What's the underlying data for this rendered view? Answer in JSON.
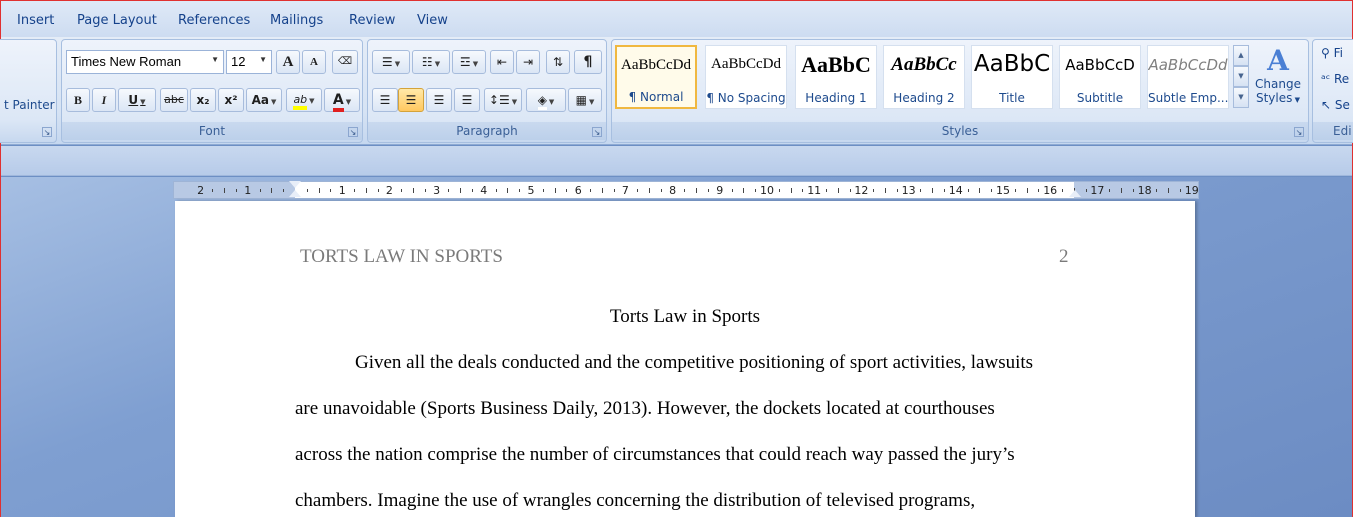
{
  "tabs": [
    "Insert",
    "Page Layout",
    "References",
    "Mailings",
    "Review",
    "View"
  ],
  "clipboard": {
    "format_painter_label": "t Painter"
  },
  "font_group": {
    "label": "Font",
    "font_name": "Times New Roman",
    "font_size": "12",
    "grow": "A",
    "shrink": "A",
    "bold": "B",
    "italic": "I",
    "underline": "U",
    "strike": "abc",
    "subscript": "x₂",
    "superscript": "x²",
    "change_case": "Aa",
    "highlight": "ab",
    "font_color": "A"
  },
  "paragraph_group": {
    "label": "Paragraph",
    "pilcrow": "¶"
  },
  "styles_group": {
    "label": "Styles",
    "change_styles": [
      "Change",
      "Styles"
    ],
    "tiles": [
      {
        "sample": "AaBbCcDd",
        "name": "¶ Normal"
      },
      {
        "sample": "AaBbCcDd",
        "name": "¶ No Spacing"
      },
      {
        "sample": "AaBbC",
        "name": "Heading 1"
      },
      {
        "sample": "AaBbCc",
        "name": "Heading 2"
      },
      {
        "sample": "AaBbC",
        "name": "Title"
      },
      {
        "sample": "AaBbCcD",
        "name": "Subtitle"
      },
      {
        "sample": "AaBbCcDd",
        "name": "Subtle Emp..."
      }
    ]
  },
  "editing_group": {
    "label": "Edi",
    "items": [
      "Fi",
      "Re",
      "Se"
    ]
  },
  "ruler": {
    "numbers": [
      "2",
      "1",
      "1",
      "2",
      "3",
      "4",
      "5",
      "6",
      "7",
      "8",
      "9",
      "10",
      "11",
      "12",
      "13",
      "14",
      "15",
      "16",
      "17",
      "18",
      "19"
    ]
  },
  "document": {
    "header_title": "TORTS LAW IN SPORTS",
    "header_page": "2",
    "title": "Torts Law in Sports",
    "lines": [
      "Given all the deals conducted and the competitive positioning of sport activities, lawsuits",
      "are unavoidable (Sports Business Daily, 2013). However, the dockets located at courthouses",
      "across the nation comprise the number of circumstances that could reach way passed the jury’s",
      "chambers. Imagine the use of wrangles concerning the distribution of televised programs,"
    ]
  }
}
